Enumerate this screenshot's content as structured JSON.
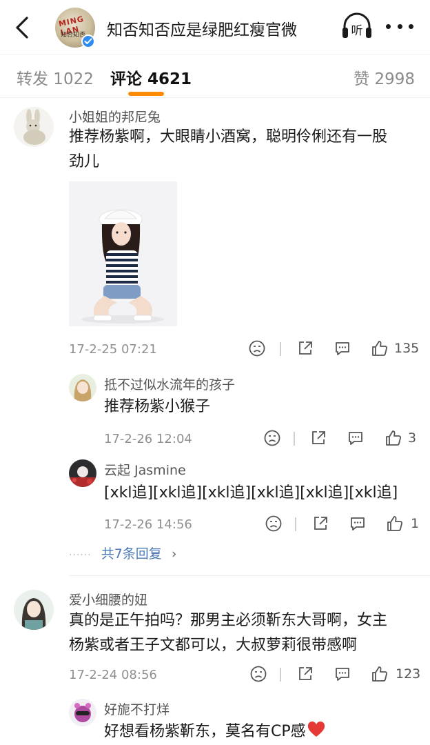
{
  "header": {
    "title": "知否知否应是绿肥红瘦官微",
    "avatar_logo": "MING LAN",
    "avatar_sub": "知否知否",
    "listen_label": "听"
  },
  "tabs": {
    "repost": "转发 1022",
    "comment": "评论 4621",
    "like": "赞 2998"
  },
  "comments": [
    {
      "user": "小姐姐的邦尼兔",
      "text_line1": "推荐杨紫啊，大眼睛小酒窝，聪明伶俐还有一股",
      "text_line2": "劲儿",
      "time": "17-2-25 07:21",
      "likes": "135"
    },
    {
      "user": "爱小细腰的妞",
      "text_line1": "真的是正午拍吗？那男主必须靳东大哥啊，女主",
      "text_line2": "杨紫或者王子文都可以，大叔萝莉很带感啊",
      "time": "17-2-24 08:56",
      "likes": "123"
    }
  ],
  "replies": [
    {
      "user": "抵不过似水流年的孩子",
      "text": "推荐杨紫小猴子",
      "time": "17-2-26 12:04",
      "likes": "3"
    },
    {
      "user": "云起 Jasmine",
      "text": "[xkl追][xkl追][xkl追][xkl追][xkl追][xkl追]",
      "time": "17-2-26 14:56",
      "likes": "1"
    },
    {
      "user": "好旎不打烊",
      "text": "好想看杨紫靳东，莫名有CP感"
    }
  ],
  "more_replies": {
    "dots": "······",
    "label": "共7条回复",
    "chevron": "›"
  },
  "colors": {
    "accent": "#ff8c00",
    "link": "#4a78b5",
    "verified": "#2f8bf0",
    "heart": "#e53935"
  }
}
